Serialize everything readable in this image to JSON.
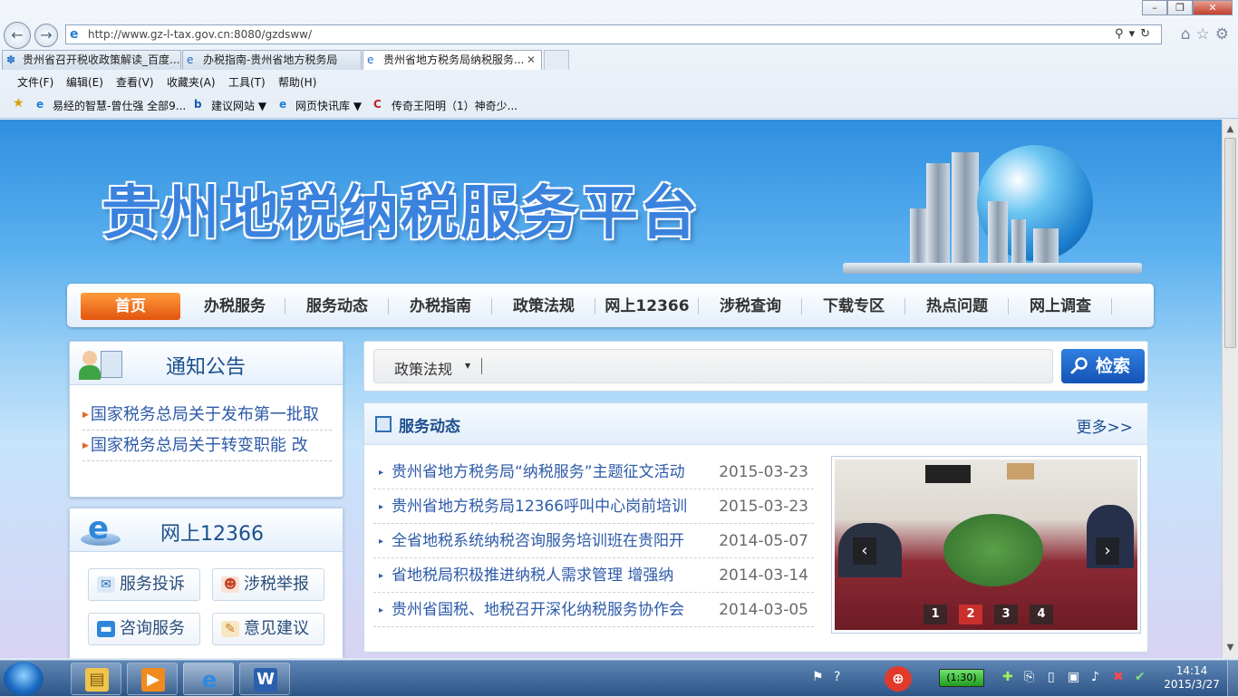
{
  "browser": {
    "url": "http://www.gz-l-tax.gov.cn:8080/gzdsww/",
    "tabs": [
      {
        "label": "贵州省召开税收政策解读_百度..."
      },
      {
        "label": "办税指南-贵州省地方税务局"
      },
      {
        "label": "贵州省地方税务局纳税服务..."
      }
    ],
    "menu": [
      "文件(F)",
      "编辑(E)",
      "查看(V)",
      "收藏夹(A)",
      "工具(T)",
      "帮助(H)"
    ],
    "favorites": [
      "易经的智慧-曾仕强 全部9...",
      "建议网站 ▼",
      "网页快讯库 ▼",
      "传奇王阳明（1）神奇少..."
    ]
  },
  "site": {
    "title": "贵州地税纳税服务平台",
    "nav": [
      "首页",
      "办税服务",
      "服务动态",
      "办税指南",
      "政策法规",
      "网上12366",
      "涉税查询",
      "下载专区",
      "热点问题",
      "网上调查"
    ]
  },
  "notice": {
    "title": "通知公告",
    "items": [
      "国家税务总局关于发布第一批取",
      "国家税务总局关于转变职能 改"
    ]
  },
  "online12366": {
    "title": "网上12366",
    "buttons": [
      "服务投诉",
      "涉税举报",
      "咨询服务",
      "意见建议"
    ]
  },
  "search": {
    "category": "政策法规",
    "button": "检索"
  },
  "news": {
    "title": "服务动态",
    "more": "更多>>",
    "items": [
      {
        "title": "贵州省地方税务局“纳税服务”主题征文活动",
        "date": "2015-03-23"
      },
      {
        "title": "贵州省地方税务局12366呼叫中心岗前培训",
        "date": "2015-03-23"
      },
      {
        "title": "全省地税系统纳税咨询服务培训班在贵阳开",
        "date": "2014-05-07"
      },
      {
        "title": "省地税局积极推进纳税人需求管理 增强纳",
        "date": "2014-03-14"
      },
      {
        "title": "贵州省国税、地税召开深化纳税服务协作会",
        "date": "2014-03-05"
      }
    ],
    "slides": [
      "1",
      "2",
      "3",
      "4"
    ],
    "active_slide": 2
  },
  "taskbar": {
    "battery": "(1:30)",
    "time": "14:14",
    "date": "2015/3/27"
  }
}
